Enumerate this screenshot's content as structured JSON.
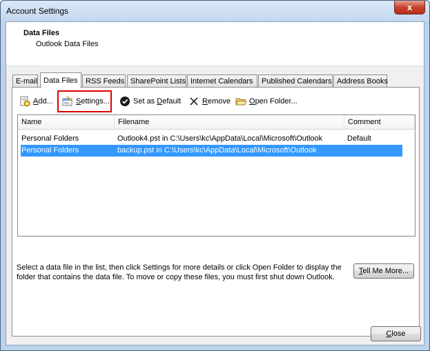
{
  "window": {
    "title": "Account Settings",
    "close_glyph": "x"
  },
  "header": {
    "title": "Data Files",
    "subtitle": "Outlook Data Files"
  },
  "tabs": [
    {
      "label": "E-mail",
      "active": false
    },
    {
      "label": "Data Files",
      "active": true
    },
    {
      "label": "RSS Feeds",
      "active": false
    },
    {
      "label": "SharePoint Lists",
      "active": false
    },
    {
      "label": "Internet Calendars",
      "active": false
    },
    {
      "label": "Published Calendars",
      "active": false
    },
    {
      "label": "Address Books",
      "active": false
    }
  ],
  "toolbar": {
    "add": {
      "pre": "",
      "key": "A",
      "post": "dd...",
      "icon": "add-data-file-icon"
    },
    "settings": {
      "pre": "",
      "key": "S",
      "post": "ettings...",
      "icon": "settings-icon"
    },
    "set_default": {
      "pre": "Set as ",
      "key": "D",
      "post": "efault",
      "icon": "check-circle-icon"
    },
    "remove": {
      "pre": "",
      "key": "R",
      "post": "emove",
      "icon": "remove-x-icon"
    },
    "open_folder": {
      "pre": "",
      "key": "O",
      "post": "pen Folder...",
      "icon": "folder-icon"
    }
  },
  "list": {
    "columns": [
      "Name",
      "Filename",
      "Comment"
    ],
    "rows": [
      {
        "name": "Personal Folders",
        "filename": "Outlook4.pst in C:\\Users\\kc\\AppData\\Local\\Microsoft\\Outlook",
        "comment": "Default",
        "selected": false
      },
      {
        "name": "Personal Folders",
        "filename": "backup.pst in C:\\Users\\kc\\AppData\\Local\\Microsoft\\Outlook",
        "comment": "",
        "selected": true
      }
    ]
  },
  "help_text": "Select a data file in the list, then click Settings for more details or click Open Folder to display the folder that contains the data file. To move or copy these files, you must first shut down Outlook.",
  "buttons": {
    "tell_me_more": {
      "pre": "",
      "key": "T",
      "post": "ell Me More..."
    },
    "close": {
      "pre": "",
      "key": "C",
      "post": "lose"
    }
  },
  "colors": {
    "selection": "#3399ff",
    "highlight_box": "#e00000",
    "close_button": "#c7442e"
  }
}
